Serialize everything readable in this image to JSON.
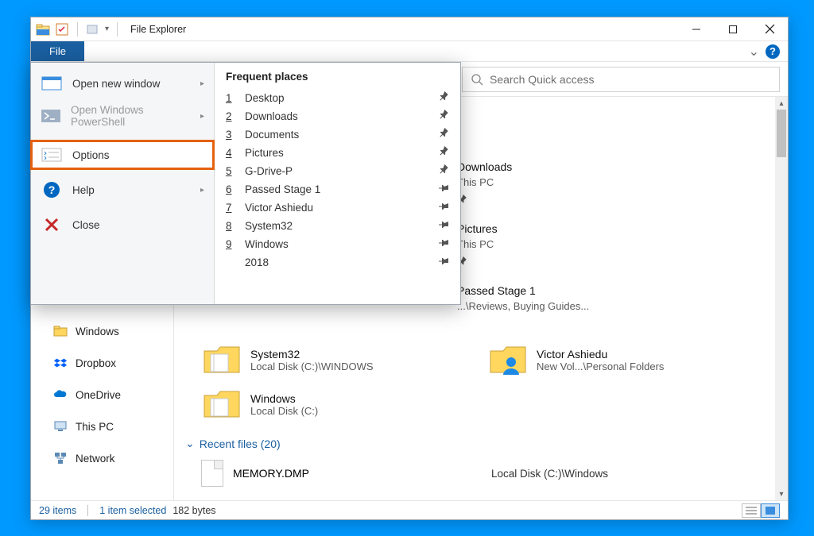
{
  "window": {
    "title": "File Explorer",
    "controls": {
      "min": "–",
      "max": "□",
      "close": "×"
    }
  },
  "ribbon": {
    "file_tab": "File",
    "caret": "⌄"
  },
  "search": {
    "placeholder": "Search Quick access"
  },
  "filemenu": {
    "items": [
      {
        "label": "Open new window",
        "has_sub": true,
        "icon": "window"
      },
      {
        "label": "Open Windows PowerShell",
        "has_sub": true,
        "disabled": true,
        "icon": "ps"
      },
      {
        "label": "Options",
        "highlight": true,
        "icon": "options"
      },
      {
        "label": "Help",
        "has_sub": true,
        "icon": "help"
      },
      {
        "label": "Close",
        "icon": "close"
      }
    ],
    "frequent_header": "Frequent places",
    "frequent": [
      {
        "n": "1",
        "label": "Desktop",
        "pin": "diag"
      },
      {
        "n": "2",
        "label": "Downloads",
        "pin": "diag"
      },
      {
        "n": "3",
        "label": "Documents",
        "pin": "diag"
      },
      {
        "n": "4",
        "label": "Pictures",
        "pin": "diag"
      },
      {
        "n": "5",
        "label": "G-Drive-P",
        "pin": "diag"
      },
      {
        "n": "6",
        "label": "Passed Stage 1",
        "pin": "flat"
      },
      {
        "n": "7",
        "label": "Victor Ashiedu",
        "pin": "flat"
      },
      {
        "n": "8",
        "label": "System32",
        "pin": "flat"
      },
      {
        "n": "9",
        "label": "Windows",
        "pin": "flat"
      },
      {
        "n": "",
        "label": "2018",
        "pin": "flat"
      }
    ]
  },
  "behind": [
    {
      "name": "Downloads",
      "sub": "This PC",
      "pinned": true
    },
    {
      "name": "Pictures",
      "sub": "This PC",
      "pinned": true
    },
    {
      "name": "Passed Stage 1",
      "sub": "...\\Reviews, Buying Guides...",
      "pinned": false
    }
  ],
  "sidebar": [
    {
      "label": "Windows",
      "icon": "folder"
    },
    {
      "label": "Dropbox",
      "icon": "dropbox"
    },
    {
      "label": "OneDrive",
      "icon": "onedrive"
    },
    {
      "label": "This PC",
      "icon": "pc"
    },
    {
      "label": "Network",
      "icon": "network"
    }
  ],
  "folders": [
    {
      "name": "System32",
      "sub": "Local Disk (C:)\\WINDOWS",
      "icon": "folder-docs"
    },
    {
      "name": "Victor Ashiedu",
      "sub": "New Vol...\\Personal Folders",
      "icon": "folder-user"
    },
    {
      "name": "Windows",
      "sub": "Local Disk (C:)",
      "icon": "folder-docs"
    }
  ],
  "recent": {
    "header": "Recent files (20)",
    "items": [
      {
        "name": "MEMORY.DMP",
        "path": "Local Disk (C:)\\Windows"
      }
    ]
  },
  "status": {
    "count": "29 items",
    "selection": "1 item selected",
    "size": "182 bytes"
  }
}
